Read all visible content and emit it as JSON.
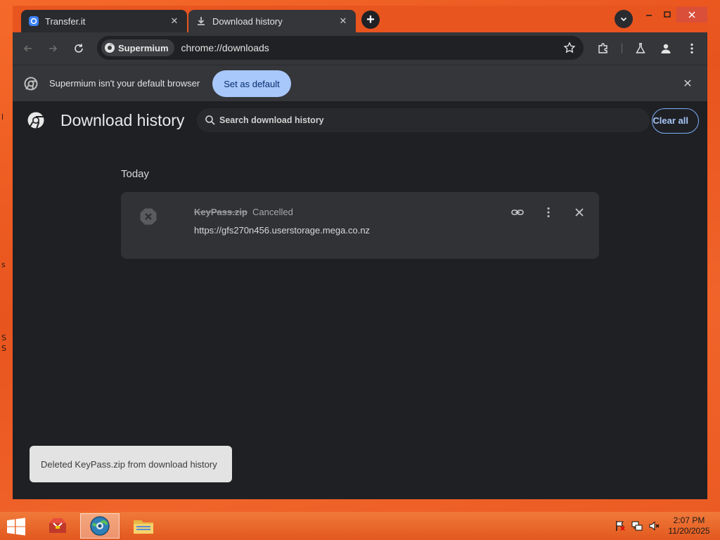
{
  "browser": {
    "tabs": [
      {
        "title": "Transfer.it",
        "icon": "transfer-icon",
        "active": false
      },
      {
        "title": "Download history",
        "icon": "download-icon",
        "active": true
      }
    ],
    "new_tab_label": "+",
    "site_chip": "Supermium",
    "url": "chrome://downloads"
  },
  "infobar": {
    "message": "Supermium isn't your default browser",
    "button": "Set as default"
  },
  "page": {
    "title": "Download history",
    "search_placeholder": "Search download history",
    "clear_all": "Clear all",
    "section_date": "Today",
    "downloads": [
      {
        "file_name": "KeyPass.zip",
        "status": "Cancelled",
        "url": "https://gfs270n456.userstorage.mega.co.nz"
      }
    ]
  },
  "toast": {
    "message": "Deleted KeyPass.zip from download history"
  },
  "taskbar": {
    "time": "2:07 PM",
    "date": "11/20/2025"
  },
  "colors": {
    "accent": "#a8c7fa",
    "page_bg": "#1f2024",
    "desktop": "#e9551f"
  }
}
